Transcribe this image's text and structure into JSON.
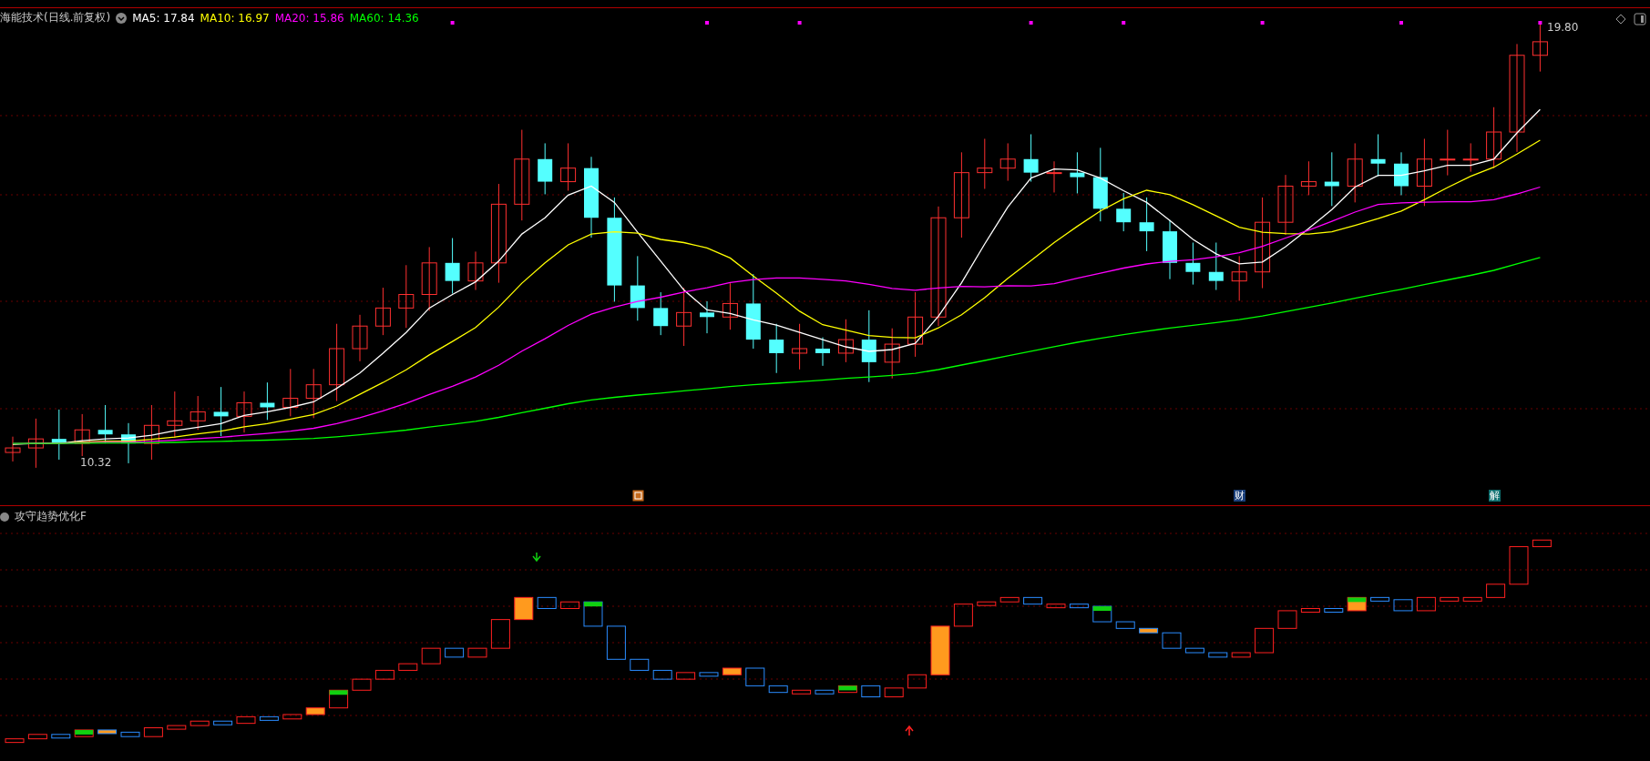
{
  "main_chart": {
    "title": "海能技术(日线.前复权)",
    "indicators": [
      {
        "label": "MA5: 17.84",
        "color": "#ffffff"
      },
      {
        "label": "MA10: 16.97",
        "color": "#ffff00"
      },
      {
        "label": "MA20: 15.86",
        "color": "#ff00ff"
      },
      {
        "label": "MA60: 14.36",
        "color": "#00ff00"
      }
    ],
    "high_label": "19.80",
    "low_label": "10.32",
    "events": [
      {
        "kind": "icon"
      },
      {
        "kind": "text",
        "text": "财"
      },
      {
        "kind": "text",
        "text": "解"
      }
    ]
  },
  "sub_chart": {
    "title": "攻守趋势优化F"
  }
}
